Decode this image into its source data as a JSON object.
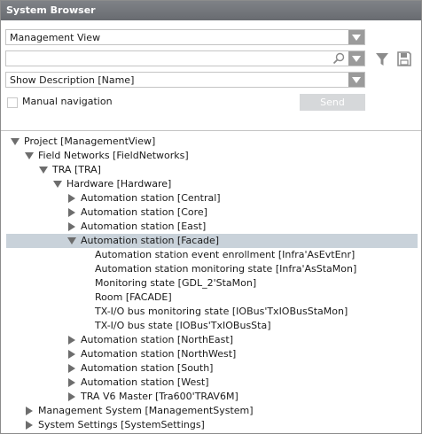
{
  "window": {
    "title": "System Browser"
  },
  "controls": {
    "view_select": "Management View",
    "search_value": "",
    "description_select": "Show Description [Name]",
    "manual_navigation_label": "Manual navigation",
    "manual_navigation_checked": false,
    "send_label": "Send"
  },
  "tree": [
    {
      "label": "Project [ManagementView]",
      "state": "expanded"
    },
    {
      "label": "Field Networks [FieldNetworks]",
      "state": "expanded"
    },
    {
      "label": "TRA [TRA]",
      "state": "expanded"
    },
    {
      "label": "Hardware [Hardware]",
      "state": "expanded"
    },
    {
      "label": "Automation station [Central]",
      "state": "collapsed"
    },
    {
      "label": "Automation station [Core]",
      "state": "collapsed"
    },
    {
      "label": "Automation station [East]",
      "state": "collapsed"
    },
    {
      "label": "Automation station [Facade]",
      "state": "expanded",
      "selected": true
    },
    {
      "label": "Automation station event enrollment [Infra'AsEvtEnr]",
      "state": "leaf"
    },
    {
      "label": "Automation station monitoring state [Infra'AsStaMon]",
      "state": "leaf"
    },
    {
      "label": "Monitoring state [GDL_2'StaMon]",
      "state": "leaf"
    },
    {
      "label": "Room [FACADE]",
      "state": "leaf"
    },
    {
      "label": "TX-I/O bus monitoring state [IOBus'TxIOBusStaMon]",
      "state": "leaf"
    },
    {
      "label": "TX-I/O bus state [IOBus'TxIOBusSta]",
      "state": "leaf"
    },
    {
      "label": "Automation station [NorthEast]",
      "state": "collapsed"
    },
    {
      "label": "Automation station [NorthWest]",
      "state": "collapsed"
    },
    {
      "label": "Automation station [South]",
      "state": "collapsed"
    },
    {
      "label": "Automation station [West]",
      "state": "collapsed"
    },
    {
      "label": "TRA V6 Master [Tra600'TRAV6M]",
      "state": "collapsed"
    },
    {
      "label": "Management System [ManagementSystem]",
      "state": "collapsed"
    },
    {
      "label": "System Settings [SystemSettings]",
      "state": "collapsed"
    }
  ]
}
